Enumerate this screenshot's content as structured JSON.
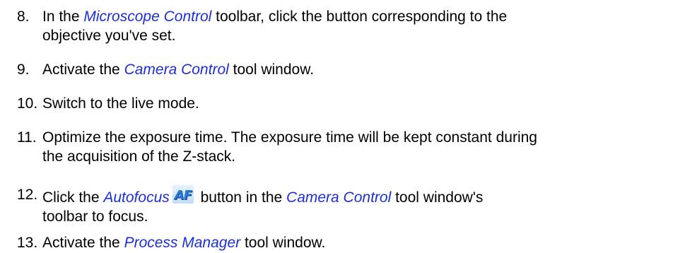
{
  "steps": [
    {
      "num": "8.",
      "line1_a": "In the ",
      "line1_ui": "Microscope Control",
      "line1_b": " toolbar, click the button corresponding to the",
      "line2": "objective you've set."
    },
    {
      "num": "9.",
      "a": "Activate the ",
      "ui": "Camera Control",
      "b": " tool window."
    },
    {
      "num": "10.",
      "text": "Switch to the live mode."
    },
    {
      "num": "11.",
      "line1": "Optimize the exposure time. The exposure time will be kept constant during",
      "line2": "the acquisition of the Z-stack."
    },
    {
      "num": "12.",
      "a": "Click the ",
      "ui1": "Autofocus",
      "icon_text": "AF",
      "b": " button in the ",
      "ui2": "Camera Control",
      "c": " tool window's",
      "line2": "toolbar to focus."
    },
    {
      "num": "13.",
      "a": "Activate the ",
      "ui": "Process Manager",
      "b": " tool window."
    }
  ],
  "icons": {
    "autofocus": "autofocus-af-icon"
  },
  "colors": {
    "ui_link": "#1a2fd6",
    "text": "#000000"
  }
}
